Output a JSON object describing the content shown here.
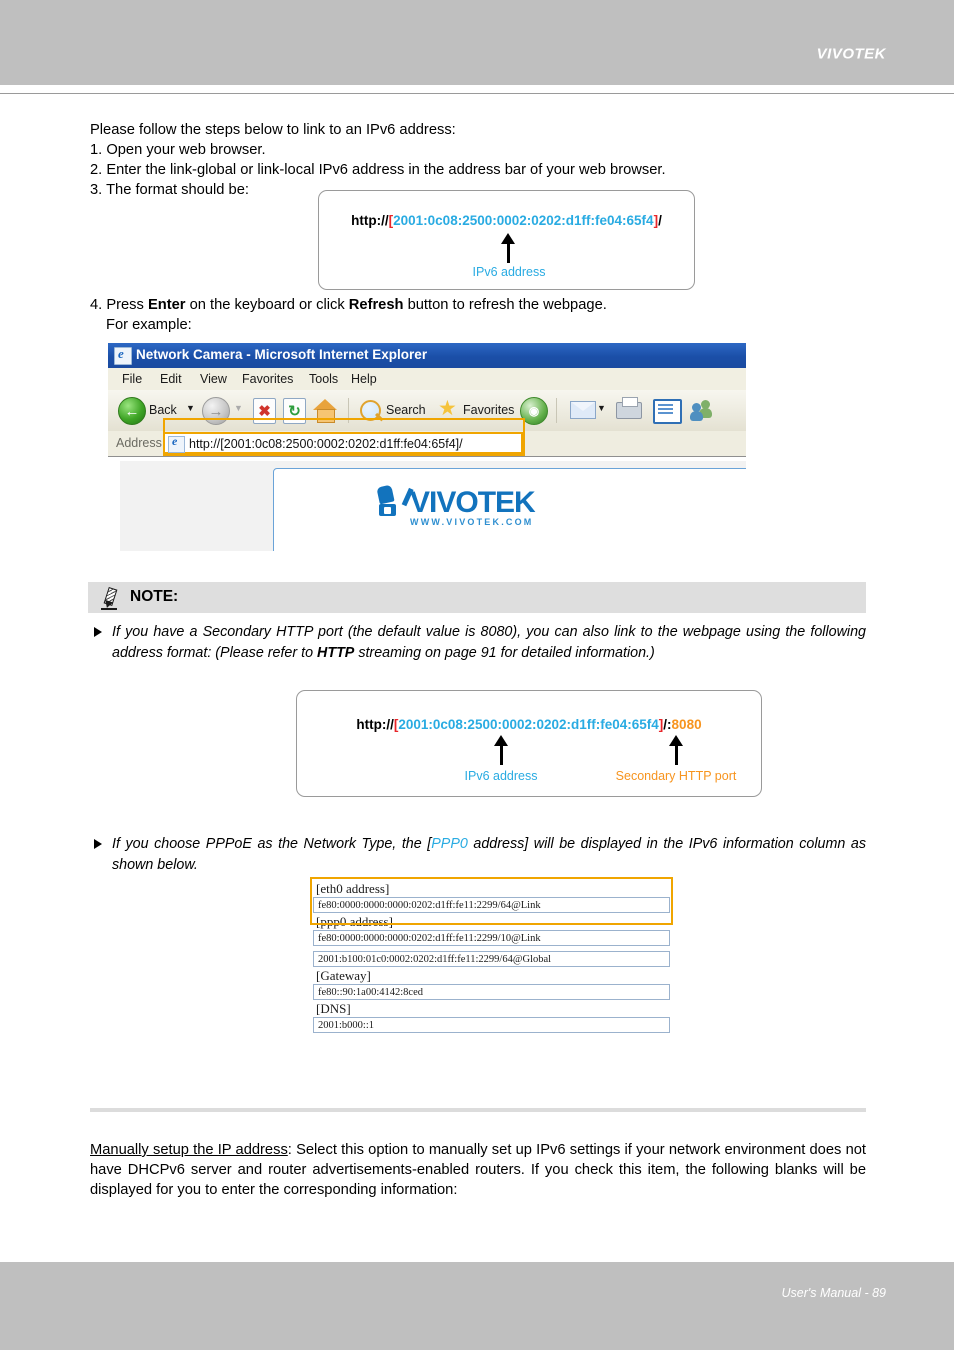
{
  "header": {
    "brand": "VIVOTEK"
  },
  "footer": {
    "text": "User's Manual - 89"
  },
  "intro": {
    "lead": "Please follow the steps below to link to an IPv6 address:",
    "step1": "1. Open your web browser.",
    "step2": "2. Enter the link-global or link-local IPv6 address in the address bar of your web browser.",
    "step3": "3. The format should be:"
  },
  "url_box_1": {
    "scheme": "http://",
    "bracket_open": "[",
    "address": "2001:0c08:2500:0002:0202:d1ff:fe04:65f4",
    "bracket_close": "]",
    "trailing": "/",
    "arrow_label": "IPv6 address"
  },
  "step4": {
    "prefix": "4. Press ",
    "enter": "Enter",
    "middle": " on the keyboard or click ",
    "refresh": "Refresh",
    "suffix": " button to refresh the webpage.",
    "example": "For example:"
  },
  "browser": {
    "title": "Network Camera - Microsoft Internet Explorer",
    "menu": [
      "File",
      "Edit",
      "View",
      "Favorites",
      "Tools",
      "Help"
    ],
    "toolbar": {
      "back": "Back",
      "search": "Search",
      "favorites": "Favorites"
    },
    "address_label": "Address",
    "address_value": "http://[2001:0c08:2500:0002:0202:d1ff:fe04:65f4]/",
    "logo_text": "VIVOTEK",
    "logo_sub": "WWW.VIVOTEK.COM"
  },
  "note": {
    "title": "NOTE:",
    "bullet1": {
      "part1": "If you have a Secondary HTTP port (the default value is 8080), you can also link to the webpage using the following address format: (Please refer to ",
      "strong": "HTTP",
      "part2": " streaming on page 91 for detailed information.)"
    },
    "bullet2": {
      "part1": "If you choose PPPoE as the Network Type, the [",
      "highlight": "PPP0",
      "part2": " address] will be displayed in the IPv6 information column as shown below."
    }
  },
  "url_box_2": {
    "scheme": "http://",
    "bracket_open": "[",
    "address": "2001:0c08:2500:0002:0202:d1ff:fe04:65f4",
    "bracket_close": "]",
    "separator": "/:",
    "port": "8080",
    "arrow_label_address": "IPv6 address",
    "arrow_label_port": "Secondary HTTP port"
  },
  "ipv6_table": {
    "rows": [
      {
        "label": "[eth0 address]",
        "values": [
          "fe80:0000:0000:0000:0202:d1ff:fe11:2299/64@Link"
        ]
      },
      {
        "label": "[ppp0 address]",
        "values": [
          "fe80:0000:0000:0000:0202:d1ff:fe11:2299/10@Link",
          "2001:b100:01c0:0002:0202:d1ff:fe11:2299/64@Global"
        ]
      },
      {
        "label": "[Gateway]",
        "values": [
          "fe80::90:1a00:4142:8ced"
        ]
      },
      {
        "label": "[DNS]",
        "values": [
          "2001:b000::1"
        ]
      }
    ]
  },
  "bottom": {
    "term": "Manually setup the IP address",
    "rest": ": Select this option to manually set up IPv6 settings if your network environment does not have DHCPv6 server and router advertisements-enabled routers. If you check this item, the following blanks will be displayed for you to enter the corresponding information:"
  },
  "colors": {
    "header_band": "#bfbfbf",
    "ipv6_blue": "#29abe2",
    "bracket_red": "#e8262a",
    "port_orange": "#f7941e",
    "highlight_orange": "#f0a500",
    "logo_blue": "#1273bd"
  }
}
